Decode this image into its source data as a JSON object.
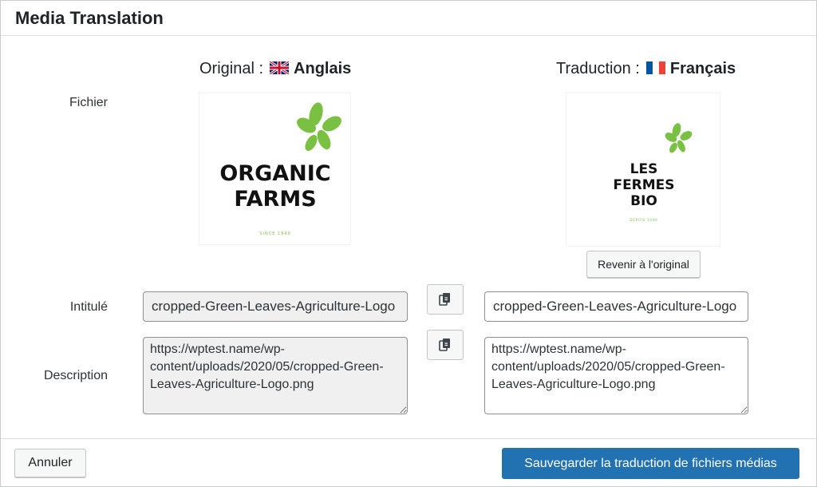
{
  "window": {
    "title": "Media Translation"
  },
  "columns": {
    "original": {
      "prefix": "Original :",
      "flag_icon": "uk-flag-icon",
      "language": "Anglais"
    },
    "translation": {
      "prefix": "Traduction :",
      "flag_icon": "france-flag-icon",
      "language": "Français"
    }
  },
  "rows": {
    "file_label": "Fichier",
    "title_label": "Intitulé",
    "description_label": "Description"
  },
  "original_image": {
    "line1": "ORGANIC",
    "line2": "FARMS",
    "tagline": "SINCE 1949",
    "leaf_color": "#7ac143"
  },
  "translated_image": {
    "line1": "LES",
    "line2": "FERMES",
    "line3": "BIO",
    "tagline": "DEPUIS 1949",
    "leaf_color": "#7ac143"
  },
  "revert_button": {
    "label": "Revenir à l'original"
  },
  "fields": {
    "original_title": "cropped-Green-Leaves-Agriculture-Logo",
    "translated_title": "cropped-Green-Leaves-Agriculture-Logo",
    "original_description": "https://wptest.name/wp-content/uploads/2020/05/cropped-Green-Leaves-Agriculture-Logo.png",
    "translated_description": "https://wptest.name/wp-content/uploads/2020/05/cropped-Green-Leaves-Agriculture-Logo.png"
  },
  "footer": {
    "cancel_label": "Annuler",
    "save_label": "Sauvegarder la traduction de fichiers médias"
  },
  "colors": {
    "primary": "#2271b1",
    "readonly_bg": "#f0f0f1"
  }
}
